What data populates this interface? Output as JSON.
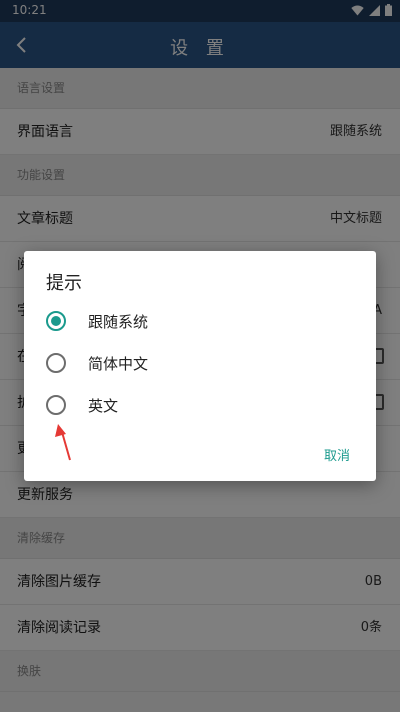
{
  "status_bar": {
    "time": "10:21",
    "icons": [
      "wifi-icon",
      "signal-icon",
      "battery-icon"
    ]
  },
  "app_bar": {
    "title": "设 置",
    "back_icon": "back-arrow-icon"
  },
  "settings": {
    "section_language": "语言设置",
    "interface_language": {
      "label": "界面语言",
      "value": "跟随系统"
    },
    "section_function": "功能设置",
    "article_title": {
      "label": "文章标题",
      "value": "中文标题"
    },
    "partial_rows": [
      "阅",
      "字",
      "在",
      "护"
    ],
    "partial_value": "A",
    "row_update_partial": "更",
    "update_service": {
      "label": "更新服务"
    },
    "section_cache": "清除缓存",
    "clear_image_cache": {
      "label": "清除图片缓存",
      "value": "0B"
    },
    "clear_reading_history": {
      "label": "清除阅读记录",
      "value": "0条"
    },
    "section_skin": "换肤"
  },
  "dialog": {
    "title": "提示",
    "options": [
      {
        "label": "跟随系统",
        "selected": true
      },
      {
        "label": "简体中文",
        "selected": false
      },
      {
        "label": "英文",
        "selected": false
      }
    ],
    "cancel_label": "取消",
    "accent_color": "#1a9a8d"
  },
  "colors": {
    "app_bar": "#2a5788",
    "status_bar": "#1f3a5c",
    "annotation_arrow": "#e53935"
  }
}
